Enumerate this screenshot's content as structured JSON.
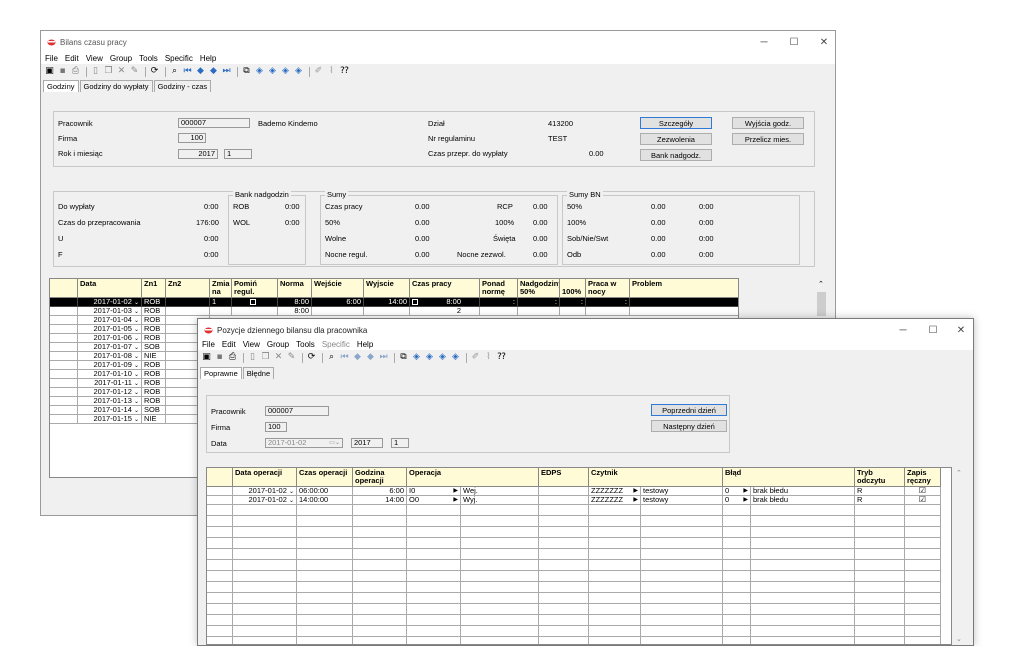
{
  "back_window": {
    "title": "Bilans czasu pracy",
    "menu": [
      "File",
      "Edit",
      "View",
      "Group",
      "Tools",
      "Specific",
      "Help"
    ],
    "tabs": [
      "Godziny",
      "Godziny do wypłaty",
      "Godziny - czas"
    ],
    "pracownik_label": "Pracownik",
    "pracownik_value": "000007",
    "pracownik_name": "Bademo Kindemo",
    "firma_label": "Firma",
    "firma_value": "100",
    "rok_label": "Rok i miesiąc",
    "rok_value": "2017",
    "miesiac_value": "1",
    "dzial_label": "Dział",
    "dzial_value": "413200",
    "nr_label": "Nr regulaminu",
    "nr_value": "TEST",
    "czas_label": "Czas przepr. do wypłaty",
    "czas_value": "0.00",
    "btn_szczegoly": "Szczegóły",
    "btn_zezwolenia": "Zezwolenia",
    "btn_bank": "Bank nadgodz.",
    "btn_wyjscia": "Wyjścia godz.",
    "btn_przelicz": "Przelicz mies.",
    "left_rows": [
      {
        "label": "Do wypłaty",
        "value": "0:00"
      },
      {
        "label": "Czas do przepracowania",
        "value": "176:00"
      },
      {
        "label": "U",
        "value": "0:00"
      },
      {
        "label": "F",
        "value": "0:00"
      }
    ],
    "bank_title": "Bank nadgodzin",
    "bank_rows": [
      {
        "label": "ROB",
        "value": "0:00"
      },
      {
        "label": "WOL",
        "value": "0:00"
      }
    ],
    "sumy_title": "Sumy",
    "sumy_rows": [
      {
        "a": "Czas pracy",
        "b": "0.00",
        "c": "RCP",
        "d": "0.00"
      },
      {
        "a": "50%",
        "b": "0.00",
        "c": "100%",
        "d": "0.00"
      },
      {
        "a": "Wolne",
        "b": "0.00",
        "c": "Święta",
        "d": "0.00"
      },
      {
        "a": "Nocne regul.",
        "b": "0.00",
        "c": "Nocne zezwol.",
        "d": "0.00"
      }
    ],
    "sumybn_title": "Sumy BN",
    "sumybn_rows": [
      {
        "a": "50%",
        "b": "0.00",
        "c": "0:00"
      },
      {
        "a": "100%",
        "b": "0.00",
        "c": "0:00"
      },
      {
        "a": "Sob/Nie/Swt",
        "b": "0.00",
        "c": "0:00"
      },
      {
        "a": "Odb",
        "b": "0.00",
        "c": "0:00"
      }
    ],
    "grid_headers": [
      "Data",
      "Zn1",
      "Zn2",
      "Zmia na",
      "Pomiń regul.",
      "Norma",
      "Wejście",
      "Wyjscie",
      "Czas pracy",
      "Ponad normę",
      "Nadgodziny 50%",
      "100%",
      "Praca w nocy",
      "Problem"
    ],
    "selected_row": {
      "date": "2017-01-02",
      "zn1": "ROB",
      "zmiana": "1",
      "norma": "8:00",
      "wejscie": "6:00",
      "wyjscie": "14:00",
      "czas": "8:00"
    },
    "row2_norma": "8:00",
    "row2_mark": "2",
    "rows": [
      {
        "date": "2017-01-03",
        "zn1": "ROB"
      },
      {
        "date": "2017-01-04",
        "zn1": "ROB"
      },
      {
        "date": "2017-01-05",
        "zn1": "ROB"
      },
      {
        "date": "2017-01-06",
        "zn1": "ROB"
      },
      {
        "date": "2017-01-07",
        "zn1": "SOB"
      },
      {
        "date": "2017-01-08",
        "zn1": "NIE"
      },
      {
        "date": "2017-01-09",
        "zn1": "ROB"
      },
      {
        "date": "2017-01-10",
        "zn1": "ROB"
      },
      {
        "date": "2017-01-11",
        "zn1": "ROB"
      },
      {
        "date": "2017-01-12",
        "zn1": "ROB"
      },
      {
        "date": "2017-01-13",
        "zn1": "ROB"
      },
      {
        "date": "2017-01-14",
        "zn1": "SOB"
      },
      {
        "date": "2017-01-15",
        "zn1": "NIE"
      }
    ]
  },
  "front_window": {
    "title": "Pozycje dziennego bilansu dla pracownika",
    "menu": [
      "File",
      "Edit",
      "View",
      "Group",
      "Tools",
      "Specific",
      "Help"
    ],
    "tabs": [
      "Poprawne",
      "Błędne"
    ],
    "pracownik_label": "Pracownik",
    "pracownik_value": "000007",
    "firma_label": "Firma",
    "firma_value": "100",
    "data_label": "Data",
    "data_value": "2017-01-02",
    "year_value": "2017",
    "month_value": "1",
    "btn_prev": "Poprzedni dzień",
    "btn_next": "Następny dzień",
    "grid_headers": [
      "Data operacji",
      "Czas operacji",
      "Godzina operacji",
      "Operacja",
      "EDPS",
      "Czytnik",
      "Błąd",
      "Tryb odczytu",
      "Zapis ręczny"
    ],
    "rows": [
      {
        "date": "2017-01-02",
        "czas": "06:00:00",
        "godz": "6:00",
        "op_code": "I0",
        "op_name": "Wej.",
        "czytnik": "ZZZZZZZ",
        "czytnik_name": "testowy",
        "blad_code": "0",
        "blad_name": "brak błedu",
        "tryb": "R",
        "zapis": "☑"
      },
      {
        "date": "2017-01-02",
        "czas": "14:00:00",
        "godz": "14:00",
        "op_code": "O0",
        "op_name": "Wyj.",
        "czytnik": "ZZZZZZZ",
        "czytnik_name": "testowy",
        "blad_code": "0",
        "blad_name": "brak błedu",
        "tryb": "R",
        "zapis": "☑"
      }
    ]
  },
  "colors": {
    "header_bg": "#fffbd6",
    "selected_row": "#000000",
    "title_icon": "#e03030"
  }
}
